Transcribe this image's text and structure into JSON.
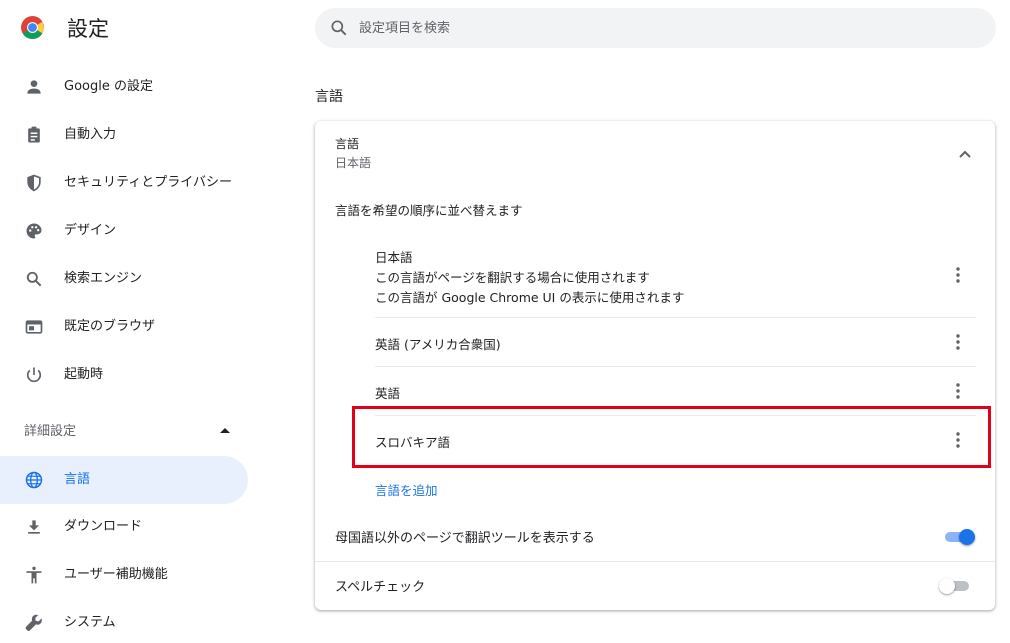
{
  "header": {
    "title": "設定",
    "search_placeholder": "設定項目を検索"
  },
  "sidebar": {
    "items": [
      {
        "label": "Google の設定",
        "icon": "person-icon"
      },
      {
        "label": "自動入力",
        "icon": "clipboard-icon"
      },
      {
        "label": "セキュリティとプライバシー",
        "icon": "shield-icon"
      },
      {
        "label": "デザイン",
        "icon": "palette-icon"
      },
      {
        "label": "検索エンジン",
        "icon": "search-icon"
      },
      {
        "label": "既定のブラウザ",
        "icon": "browser-window-icon"
      },
      {
        "label": "起動時",
        "icon": "power-icon"
      }
    ],
    "advanced_label": "詳細設定",
    "advanced_items": [
      {
        "label": "言語",
        "icon": "globe-icon",
        "active": true
      },
      {
        "label": "ダウンロード",
        "icon": "download-icon"
      },
      {
        "label": "ユーザー補助機能",
        "icon": "accessibility-icon"
      },
      {
        "label": "システム",
        "icon": "wrench-icon"
      }
    ]
  },
  "main": {
    "section_title": "言語",
    "languages_card": {
      "header_label": "言語",
      "header_value": "日本語",
      "order_label": "言語を希望の順序に並べ替えます",
      "languages": [
        {
          "name": "日本語",
          "notes": [
            "この言語がページを翻訳する場合に使用されます",
            "この言語が Google Chrome UI の表示に使用されます"
          ]
        },
        {
          "name": "英語 (アメリカ合衆国)",
          "notes": []
        },
        {
          "name": "英語",
          "notes": []
        },
        {
          "name": "スロバキア語",
          "notes": []
        }
      ],
      "add_language": "言語を追加",
      "translate_offer_label": "母国語以外のページで翻訳ツールを表示する",
      "translate_offer_on": true,
      "spellcheck_label": "スペルチェック",
      "spellcheck_on": false
    }
  },
  "colors": {
    "accent": "#1a73e8",
    "active_nav_bg": "#e8f0fe",
    "highlight_box": "#e3001b"
  }
}
